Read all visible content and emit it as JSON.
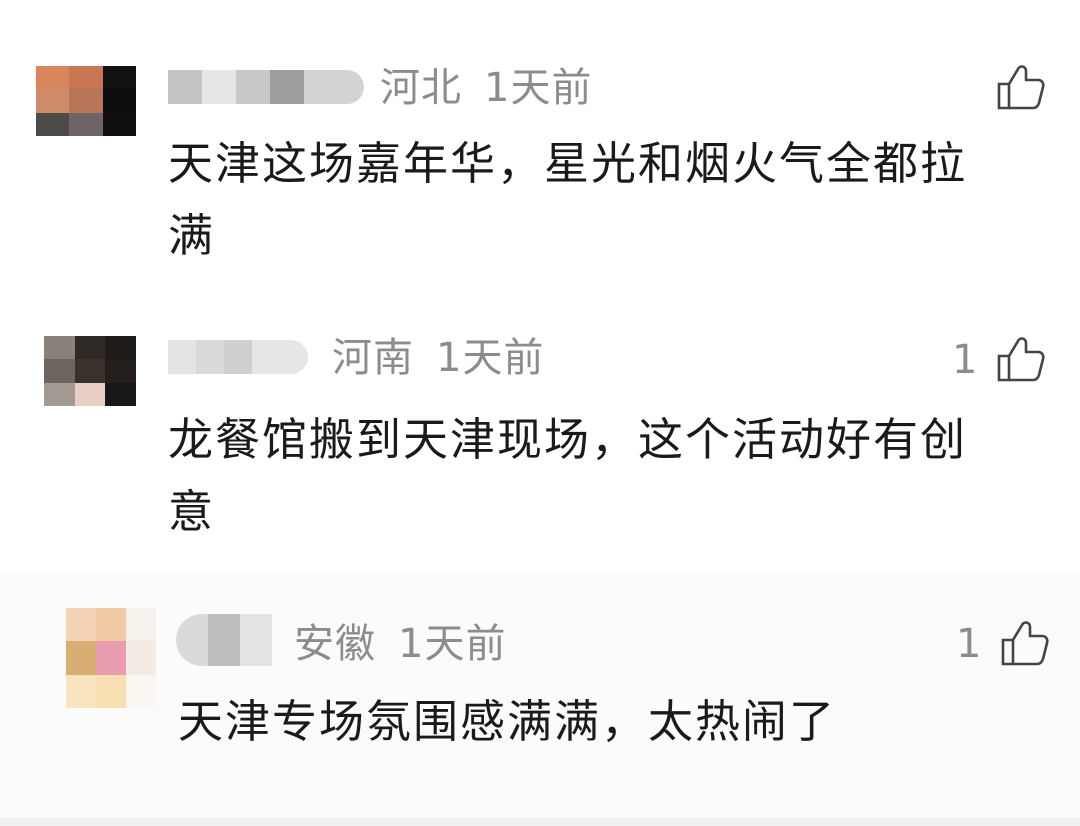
{
  "comments": [
    {
      "location": "河北",
      "time": "1天前",
      "like_count": "",
      "text_line1": "天津这场嘉年华，星光和烟火气全都拉",
      "text_line2": "满",
      "like_icon": "thumbs-up-icon"
    },
    {
      "location": "河南",
      "time": "1天前",
      "like_count": "1",
      "text_line1": "龙餐馆搬到天津现场，这个活动好有创",
      "text_line2": "意",
      "like_icon": "thumbs-up-icon"
    },
    {
      "location": "安徽",
      "time": "1天前",
      "like_count": "1",
      "text_line1": "天津专场氛围感满满，太热闹了",
      "text_line2": "",
      "like_icon": "thumbs-up-icon"
    }
  ],
  "colors": {
    "meta_text": "#8c8c8c",
    "body_text": "#1a1a1a",
    "background": "#ffffff"
  }
}
